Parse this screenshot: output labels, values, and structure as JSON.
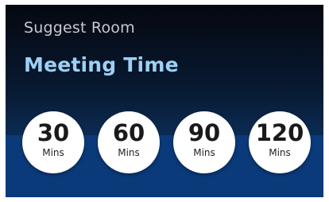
{
  "header": {
    "subtitle": "Suggest Room",
    "title": "Meeting Time"
  },
  "durations": [
    {
      "value": "30",
      "unit": "Mins"
    },
    {
      "value": "60",
      "unit": "Mins"
    },
    {
      "value": "90",
      "unit": "Mins"
    },
    {
      "value": "120",
      "unit": "Mins"
    }
  ],
  "colors": {
    "title": "#9ed0f5",
    "subtitle": "#c5c9cf",
    "band": "#0b3a7a",
    "panel_top": "#05080f"
  }
}
